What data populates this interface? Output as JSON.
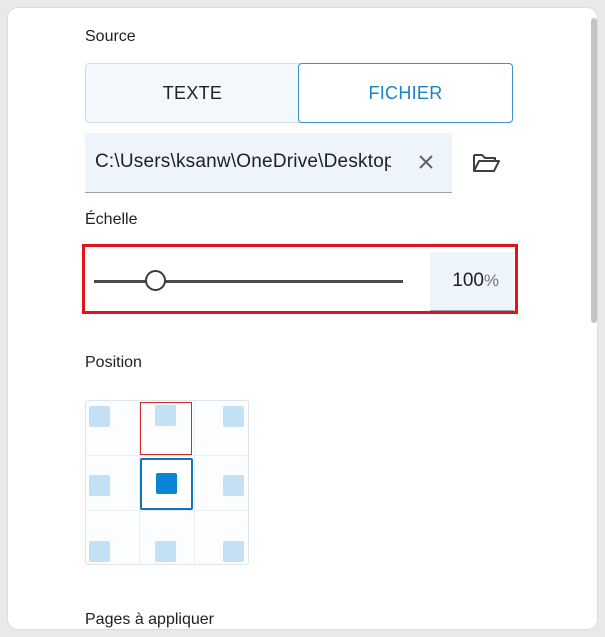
{
  "source": {
    "label": "Source",
    "tabs": [
      "TEXTE",
      "FICHIER"
    ],
    "selected_tab": "FICHIER",
    "file_path": "C:\\Users\\ksanw\\OneDrive\\Desktop"
  },
  "scale": {
    "label": "Échelle",
    "value": "100",
    "unit": "%",
    "slider_fraction": 0.2
  },
  "position": {
    "label": "Position",
    "selected": "middle-center",
    "hovered": "top-center"
  },
  "next_section": {
    "label": "Pages à appliquer"
  },
  "colors": {
    "accent": "#1a82c4",
    "highlight_outline": "#e0141b",
    "selected_cell": "#0a84d6",
    "cell": "#c3e0f5"
  }
}
